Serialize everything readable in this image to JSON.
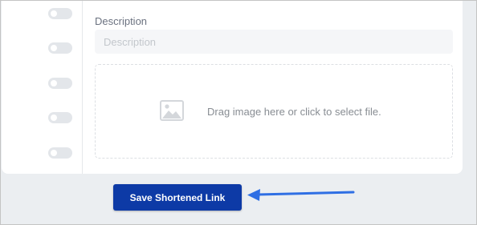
{
  "form": {
    "description_label": "Description",
    "description_value": "",
    "description_placeholder": "Description",
    "dropzone_text": "Drag image here or click to select file."
  },
  "actions": {
    "save_label": "Save Shortened Link"
  },
  "toggles": [
    {
      "on": false
    },
    {
      "on": false
    },
    {
      "on": false
    },
    {
      "on": false
    },
    {
      "on": false
    }
  ],
  "colors": {
    "accent": "#0d3aa6",
    "annotation_arrow": "#2f6fe4",
    "background": "#ebeef1",
    "panel": "#ffffff"
  },
  "icons": {
    "dropzone": "image-icon",
    "annotation": "arrow-left-icon"
  }
}
